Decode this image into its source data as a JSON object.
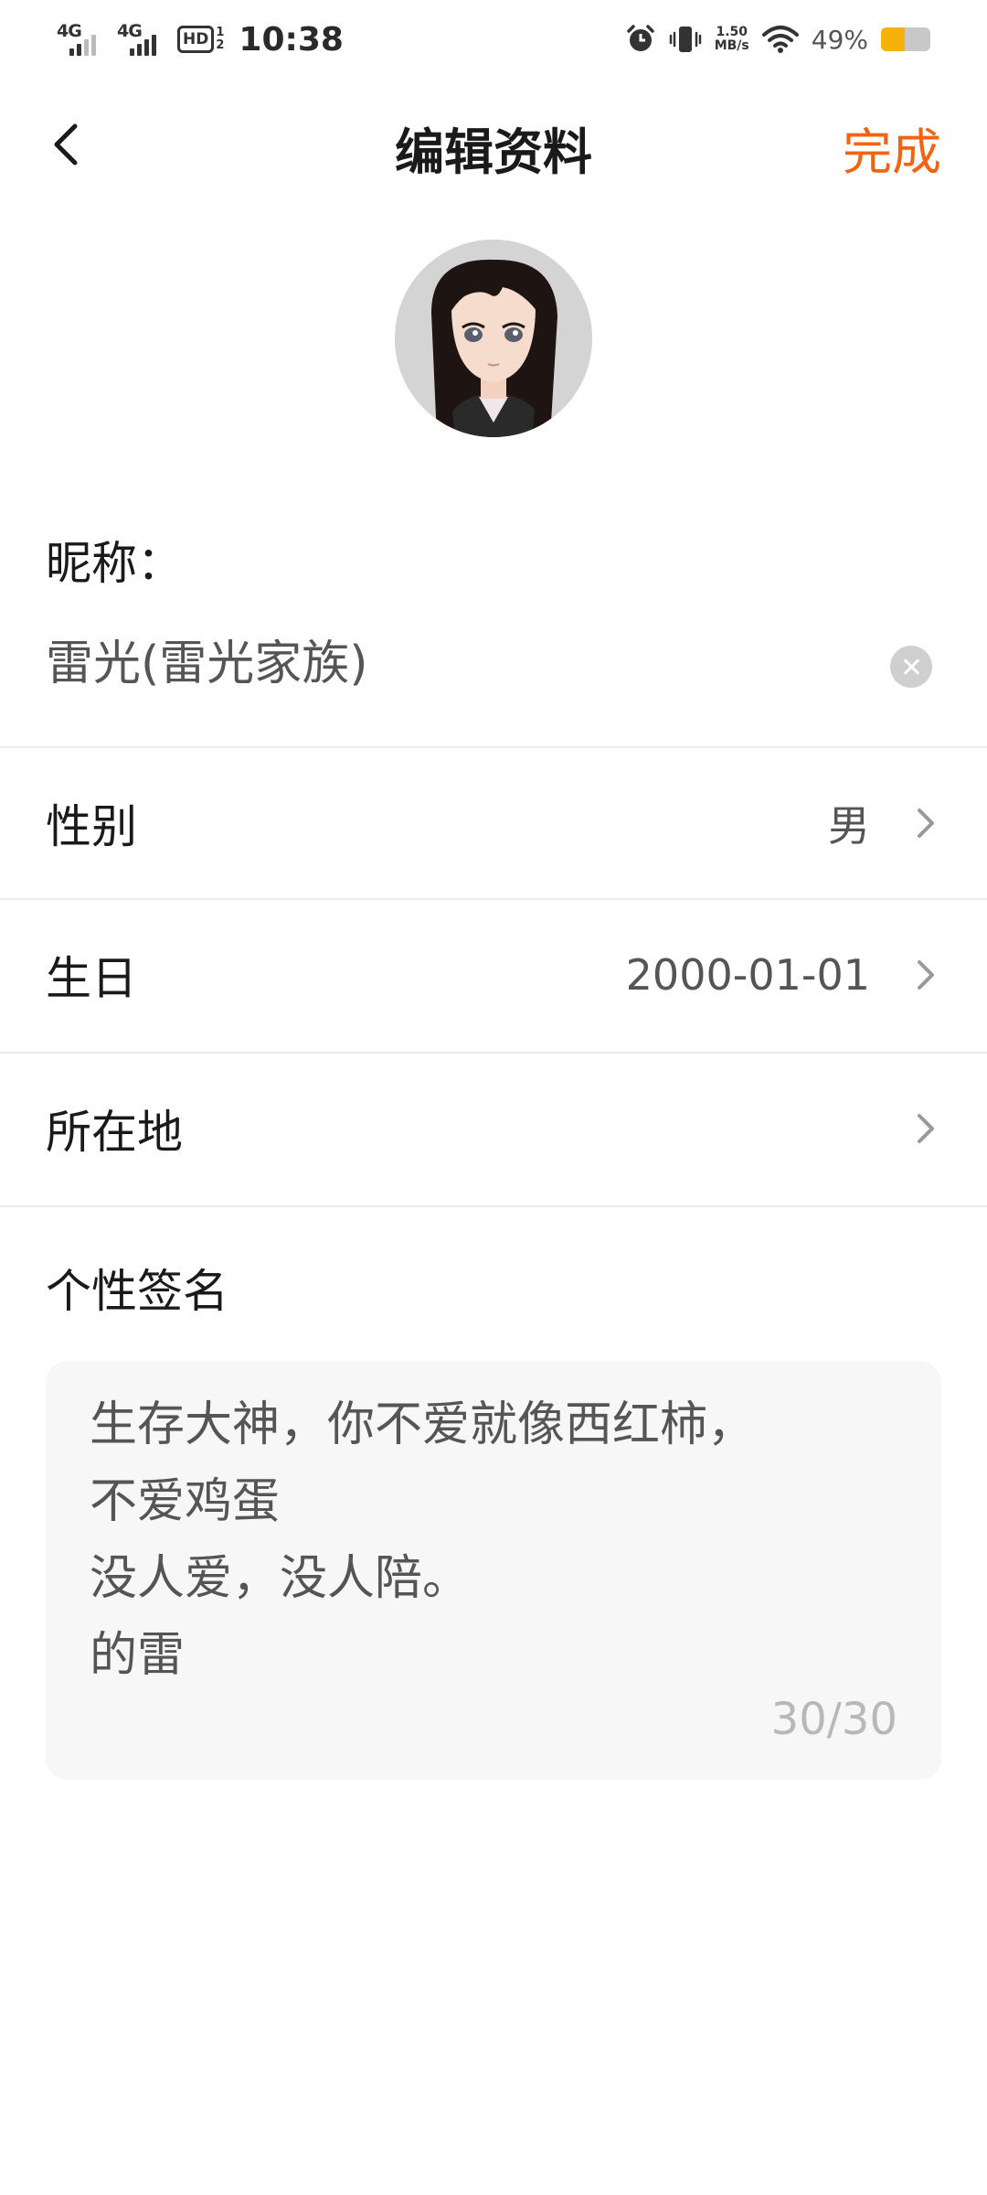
{
  "status_bar": {
    "network1": "4G",
    "network2": "4G",
    "hd_label": "HD",
    "hd_sup": "1",
    "hd_sub": "2",
    "time": "10:38",
    "net_speed_value": "1.50",
    "net_speed_unit": "MB/s",
    "battery_percent": "49%",
    "battery_level": 0.49,
    "battery_color": "#f6b10a"
  },
  "header": {
    "title": "编辑资料",
    "done_label": "完成",
    "accent_color": "#f06414"
  },
  "profile": {
    "nickname_label": "昵称：",
    "nickname_value": "雷光(雷光家族)",
    "gender_label": "性别",
    "gender_value": "男",
    "birthday_label": "生日",
    "birthday_value": "2000-01-01",
    "location_label": "所在地",
    "location_value": "",
    "signature_label": "个性签名",
    "signature_text": "生存大神，你不爱就像西红柿，\n不爱鸡蛋\n没人爱，没人陪。\n的雷",
    "signature_count": "30/30"
  }
}
